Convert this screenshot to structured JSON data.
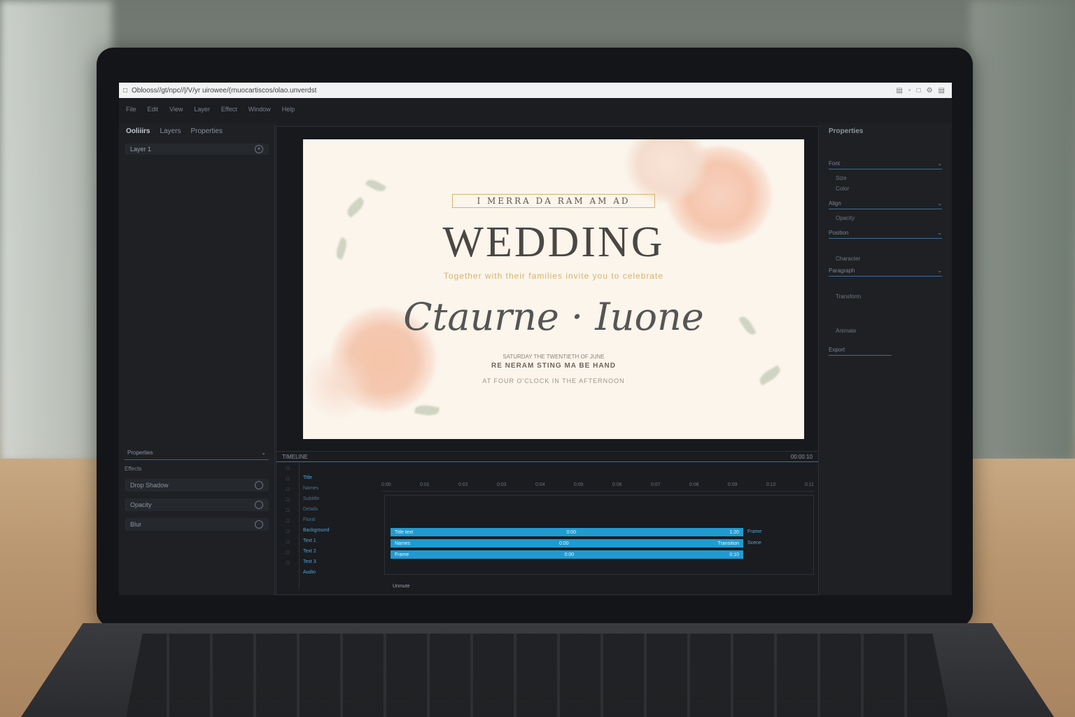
{
  "browser": {
    "url": "Oblooss//gt/npc//|/V/yr uirowee/(rnuocartiscos/olao.unverdst",
    "icons": [
      "bookmark-icon",
      "extension-icon",
      "share-icon",
      "settings-icon",
      "menu-icon"
    ]
  },
  "menu": {
    "items": [
      "File",
      "Edit",
      "View",
      "Layer",
      "Effect",
      "Window",
      "Help"
    ]
  },
  "left_panel": {
    "tabs": [
      "Ooliiirs",
      "Layers",
      "Properties"
    ],
    "layer_item": "Layer 1",
    "lower_header": "Properties",
    "lower_sub": "Effects",
    "rows": [
      "Drop Shadow",
      "Opacity",
      "Blur"
    ]
  },
  "invitation": {
    "top_text": "I MERRA DA RAM AM AD",
    "title": "WEDDING",
    "subtitle": "Together with their families invite you to celebrate",
    "names": "Ctaurne · Iuone",
    "detail1": "SATURDAY THE TWENTIETH OF JUNE",
    "detail2": "RE NERAM STING MA BE HAND",
    "detail3": "AT FOUR O'CLOCK IN THE AFTERNOON"
  },
  "timeline": {
    "header": "TIMELINE",
    "header_right": "00:00:10",
    "ruler": [
      "0:00",
      "0:01",
      "0:02",
      "0:03",
      "0:04",
      "0:05",
      "0:06",
      "0:07",
      "0:08",
      "0:09",
      "0:10",
      "0:11"
    ],
    "layers": [
      "Title",
      "Names",
      "Subtitle",
      "Details",
      "Floral",
      "Background",
      "Text 1",
      "Text 2",
      "Text 3",
      "Audio"
    ],
    "tracks": [
      {
        "label": "Title text",
        "time": "0:00",
        "end": "1:20"
      },
      {
        "label": "Names",
        "time": "0:00",
        "end": "Transition"
      },
      {
        "label": "Frame",
        "time": "0:00",
        "end": "0:10"
      }
    ],
    "track_side": [
      "Frame",
      "Scene"
    ],
    "footer": "Unmute"
  },
  "right_panel": {
    "title": "Properties",
    "fields": [
      "Font",
      "Size",
      "Color",
      "Align",
      "Opacity",
      "Position"
    ],
    "labels": [
      "Character",
      "Paragraph",
      "Transform",
      "Animate",
      "Export"
    ]
  },
  "colors": {
    "accent": "#1f9bd2",
    "gold": "#d6b46a"
  }
}
